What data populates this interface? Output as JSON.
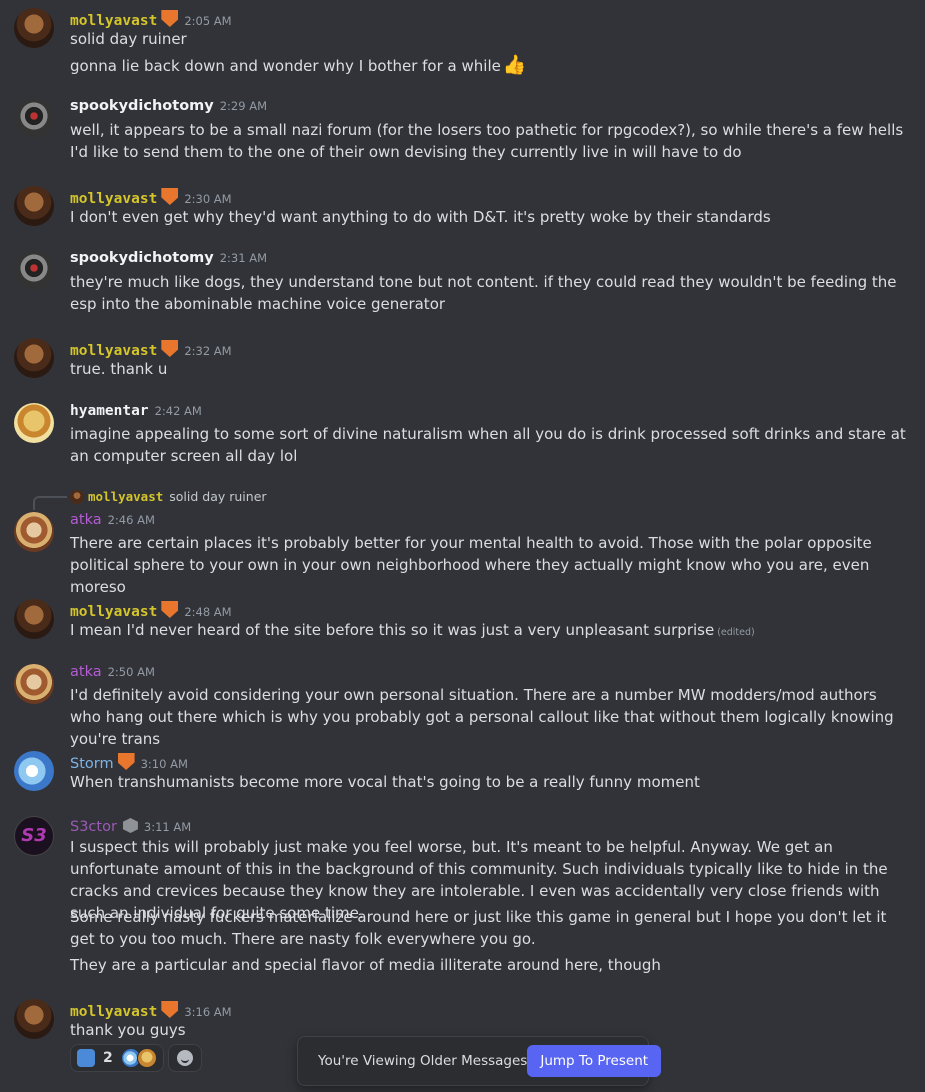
{
  "messages": [
    {
      "author": "mollyavast",
      "time": "2:05 AM",
      "lines": [
        "solid day ruiner",
        "gonna lie back down and wonder why I bother for a while"
      ],
      "thumb_emoji": "👍"
    },
    {
      "author": "spookydichotomy",
      "time": "2:29 AM",
      "lines": [
        "well, it appears to be a small nazi forum (for the losers too pathetic for rpgcodex?), so while there's a few hells I'd like to send them to the one of their own devising they currently live in will have to do"
      ]
    },
    {
      "author": "mollyavast",
      "time": "2:30 AM",
      "lines": [
        "I don't even get why they'd want anything to do with D&T. it's pretty woke by their standards"
      ]
    },
    {
      "author": "spookydichotomy",
      "time": "2:31 AM",
      "lines": [
        "they're much like dogs, they understand tone but not content. if they could read they wouldn't be feeding the esp into the abominable machine voice generator"
      ]
    },
    {
      "author": "mollyavast",
      "time": "2:32 AM",
      "lines": [
        "true. thank u"
      ]
    },
    {
      "author": "hyamentar",
      "time": "2:42 AM",
      "lines": [
        "imagine appealing to some sort of divine naturalism when all you do is drink processed soft drinks and stare at an computer screen all day lol"
      ]
    },
    {
      "author": "atka",
      "time": "2:46 AM",
      "reply_to": {
        "author": "mollyavast",
        "text": "solid day ruiner"
      },
      "lines": [
        "There are certain places it's probably better for your mental health to avoid. Those with the polar opposite political sphere to your own in your own neighborhood where they actually might know who you are, even moreso"
      ]
    },
    {
      "author": "mollyavast",
      "time": "2:48 AM",
      "lines": [
        "I mean I'd never heard of the site before this so it was just a very unpleasant surprise"
      ],
      "edited": "(edited)"
    },
    {
      "author": "atka",
      "time": "2:50 AM",
      "lines": [
        "I'd definitely avoid considering your own personal situation. There are a number MW modders/mod authors who hang out there which is why you probably got a personal callout like that without them logically knowing you're trans"
      ]
    },
    {
      "author": "Storm",
      "time": "3:10 AM",
      "lines": [
        "When transhumanists become more vocal that's going to be a really funny moment"
      ]
    },
    {
      "author": "S3ctor",
      "time": "3:11 AM",
      "avatar_text": "S3",
      "lines": [
        "I suspect this will probably just make you feel worse, but. It's meant to be helpful. Anyway. We get an unfortunate amount of this in the background of this community. Such individuals typically like to hide in the cracks and crevices because they know they are intolerable. I even was accidentally very close friends with such an individual for quite some time.",
        "Some really nasty fuckers materialize around here or just like this game in general but I hope you don't let it get to you too much. There are nasty folk everywhere you go.",
        "They are a particular and special flavor of media illiterate around here, though"
      ]
    },
    {
      "author": "mollyavast",
      "time": "3:16 AM",
      "lines": [
        "thank you guys"
      ]
    }
  ],
  "reactions": {
    "count": "2"
  },
  "older_bar": {
    "text": "You're Viewing Older Messages",
    "button": "Jump To Present"
  },
  "colors": {
    "background": "#313338",
    "molly_name": "#d4c52b",
    "atka_name": "#b65ad6",
    "storm_name": "#7fb4e6",
    "s3_name": "#9b59b6",
    "accent": "#5865f2"
  }
}
